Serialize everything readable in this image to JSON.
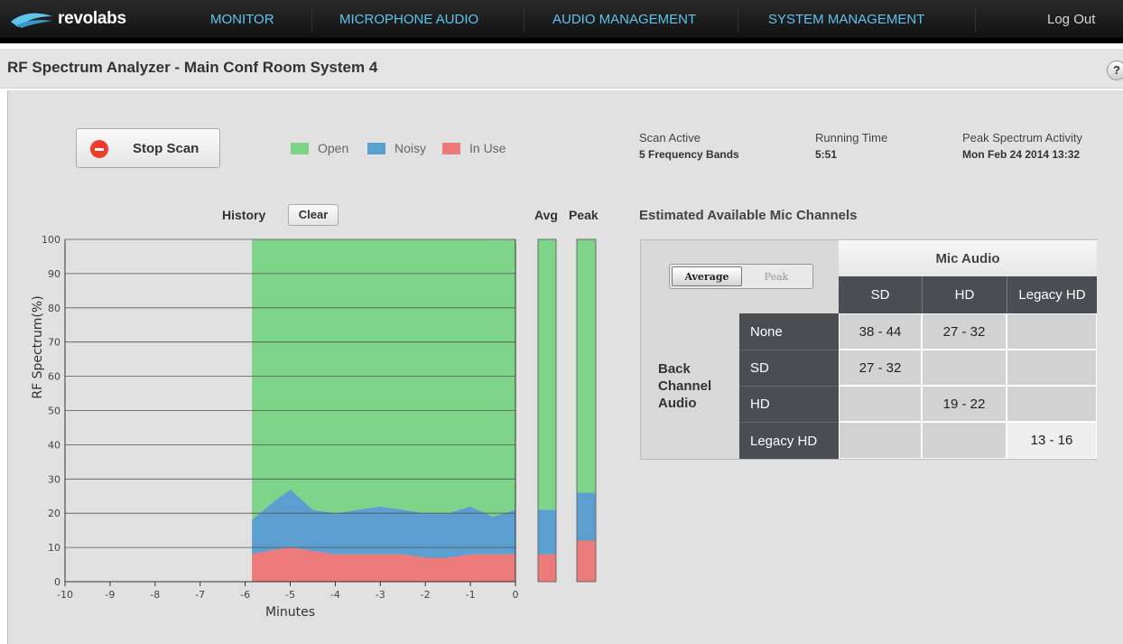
{
  "app": {
    "logo_text": "revolabs"
  },
  "nav": {
    "items": [
      "MONITOR",
      "MICROPHONE AUDIO",
      "AUDIO MANAGEMENT",
      "SYSTEM MANAGEMENT"
    ],
    "logout": "Log Out"
  },
  "page": {
    "title": "RF Spectrum Analyzer - Main Conf Room System 4",
    "help": "?"
  },
  "controls": {
    "stop_scan": "Stop Scan",
    "clear": "Clear"
  },
  "legend": [
    {
      "label": "Open",
      "color": "#7ed488"
    },
    {
      "label": "Noisy",
      "color": "#5b9fd0"
    },
    {
      "label": "In Use",
      "color": "#ec7a7a"
    }
  ],
  "status": {
    "scan_label": "Scan Active",
    "scan_value": "5 Frequency Bands",
    "running_label": "Running Time",
    "running_value": "5:51",
    "peak_label": "Peak Spectrum Activity",
    "peak_value": "Mon Feb 24 2014 13:32"
  },
  "section_labels": {
    "history": "History",
    "avg": "Avg",
    "peak": "Peak",
    "estimated": "Estimated Available Mic Channels"
  },
  "chart_data": {
    "type": "area",
    "title": "History",
    "xlabel": "Minutes",
    "ylabel": "RF Spectrum(%)",
    "xlim": [
      -10,
      0
    ],
    "ylim": [
      0,
      100
    ],
    "x_ticks": [
      -10,
      -9,
      -8,
      -7,
      -6,
      -5,
      -4,
      -3,
      -2,
      -1,
      0
    ],
    "y_ticks": [
      0,
      10,
      20,
      30,
      40,
      50,
      60,
      70,
      80,
      90,
      100
    ],
    "grid": true,
    "stacked": true,
    "x": [
      -5.85,
      -5.5,
      -5,
      -4.5,
      -4,
      -3.5,
      -3,
      -2.5,
      -2,
      -1.5,
      -1,
      -0.5,
      0
    ],
    "series": [
      {
        "name": "In Use",
        "color": "#ec7a7a",
        "values": [
          8,
          9,
          10,
          9,
          8,
          8,
          8,
          8,
          7,
          7,
          8,
          8,
          8
        ]
      },
      {
        "name": "Noisy",
        "color": "#5b9fd0",
        "values": [
          10,
          13,
          17,
          12,
          12,
          13,
          14,
          13,
          13,
          13,
          14,
          11,
          13
        ]
      },
      {
        "name": "Open",
        "color": "#7ed488",
        "values": [
          82,
          78,
          73,
          79,
          80,
          79,
          78,
          79,
          80,
          80,
          78,
          81,
          79
        ]
      }
    ],
    "avg_bar": {
      "in_use": 8,
      "noisy": 13,
      "open": 79
    },
    "peak_bar": {
      "in_use": 12,
      "noisy": 14,
      "open": 74
    }
  },
  "mic_table": {
    "toggle": {
      "average": "Average",
      "peak": "Peak"
    },
    "header": "Mic Audio",
    "columns": [
      "SD",
      "HD",
      "Legacy HD"
    ],
    "row_group": "Back Channel Audio",
    "rows": [
      {
        "label": "None",
        "values": [
          "38 - 44",
          "27 - 32",
          ""
        ]
      },
      {
        "label": "SD",
        "values": [
          "27 - 32",
          "",
          ""
        ]
      },
      {
        "label": "HD",
        "values": [
          "",
          "19 - 22",
          ""
        ]
      },
      {
        "label": "Legacy HD",
        "values": [
          "",
          "",
          "13 - 16"
        ]
      }
    ]
  }
}
